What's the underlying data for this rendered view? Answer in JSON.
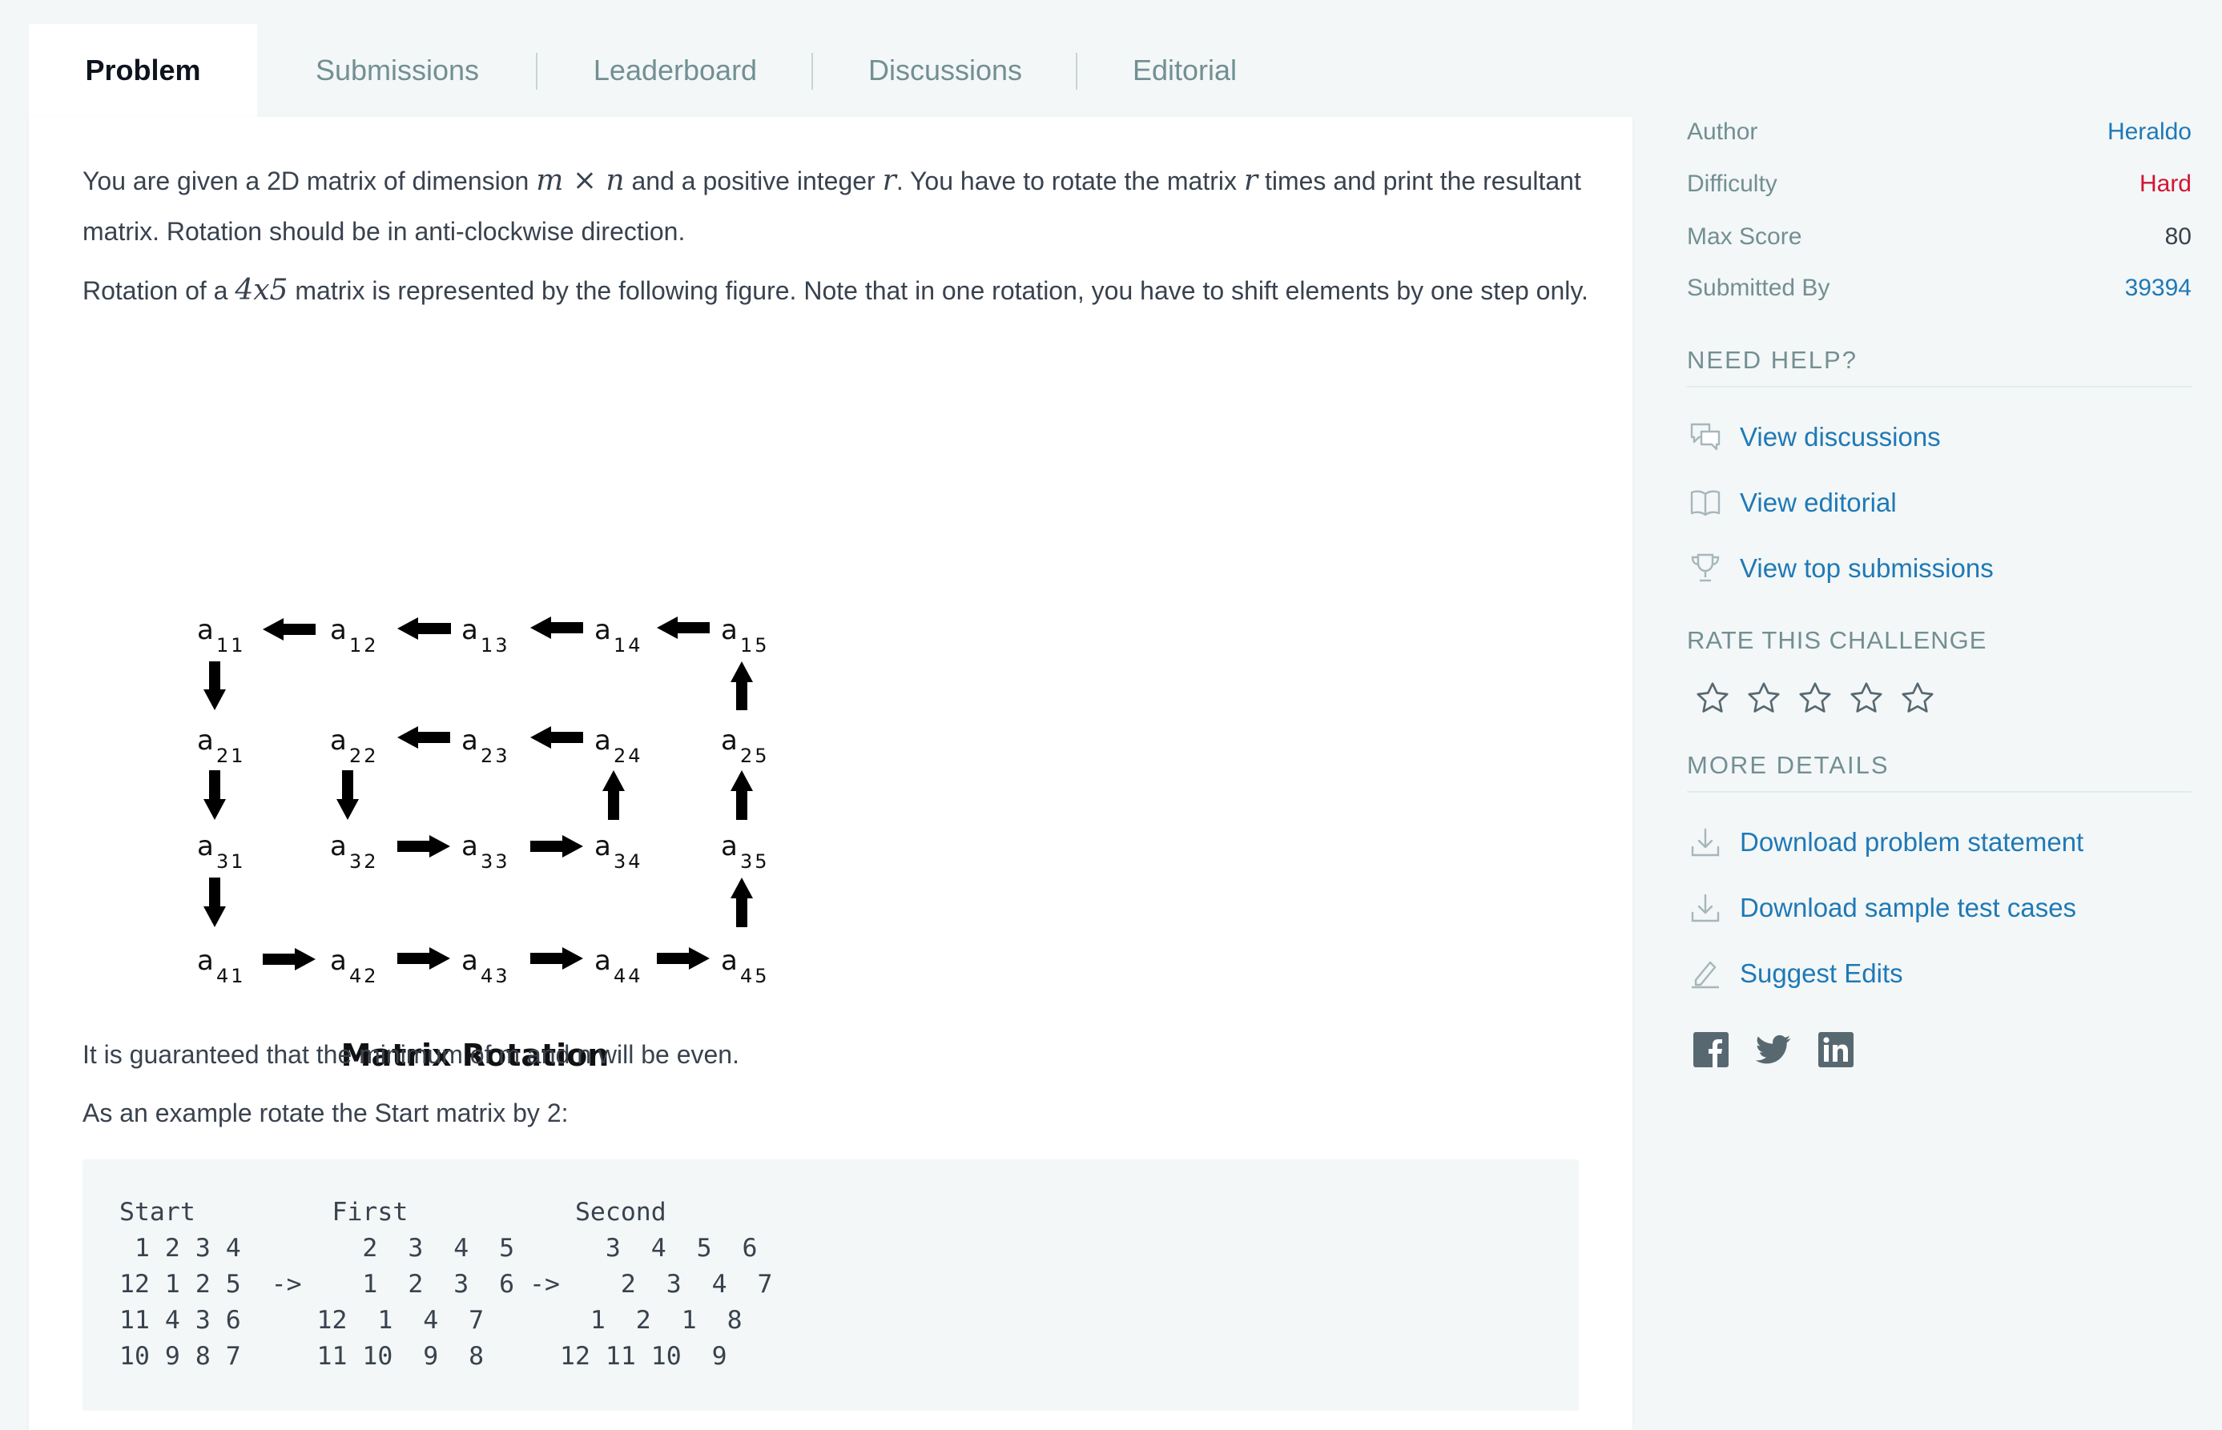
{
  "tabs": [
    "Problem",
    "Submissions",
    "Leaderboard",
    "Discussions",
    "Editorial"
  ],
  "problem": {
    "p1_a": "You are given a 2D matrix of dimension ",
    "p1_math1": "m × n",
    "p1_b": " and a positive integer ",
    "p1_math2": "r",
    "p1_c": ". You have to rotate the matrix ",
    "p1_math3": "r",
    "p1_d": " times and print the resultant matrix. Rotation should be in anti-clockwise direction.",
    "p2_a": "Rotation of a ",
    "p2_math": "4x5",
    "p2_b": " matrix is represented by the following figure. Note that in one rotation, you have to shift elements by one step only.",
    "figure": {
      "caption": "Matrix Rotation",
      "rows": [
        [
          "11",
          "12",
          "13",
          "14",
          "15"
        ],
        [
          "21",
          "22",
          "23",
          "24",
          "25"
        ],
        [
          "31",
          "32",
          "33",
          "34",
          "35"
        ],
        [
          "41",
          "42",
          "43",
          "44",
          "45"
        ]
      ],
      "letter": "a"
    },
    "p3": "It is guaranteed that the minimum of m and n will be even.",
    "p4": "As an example rotate the Start matrix by 2:",
    "code": "Start         First           Second\n 1 2 3 4        2  3  4  5      3  4  5  6\n12 1 2 5  ->    1  2  3  6 ->    2  3  4  7\n11 4 3 6     12  1  4  7       1  2  1  8\n10 9 8 7     11 10  9  8     12 11 10  9"
  },
  "sidebar": {
    "meta": [
      {
        "key": "Author",
        "value": "Heraldo"
      },
      {
        "key": "Difficulty",
        "value": "Hard"
      },
      {
        "key": "Max Score",
        "value": "80"
      },
      {
        "key": "Submitted By",
        "value": "39394"
      }
    ],
    "need_help": "NEED HELP?",
    "help_links": [
      "View discussions",
      "View editorial",
      "View top submissions"
    ],
    "rate": "RATE THIS CHALLENGE",
    "more": "MORE DETAILS",
    "more_links": [
      "Download problem statement",
      "Download sample test cases",
      "Suggest Edits"
    ],
    "icons": {
      "discussions": "chat-icon",
      "editorial": "book-icon",
      "top": "trophy-icon",
      "download": "download-icon",
      "edit": "pencil-icon",
      "social": [
        "facebook-icon",
        "twitter-icon",
        "linkedin-icon"
      ]
    },
    "colors": {
      "link": "#1f79b6",
      "hard": "#d11534",
      "muted": "#738f93"
    }
  }
}
